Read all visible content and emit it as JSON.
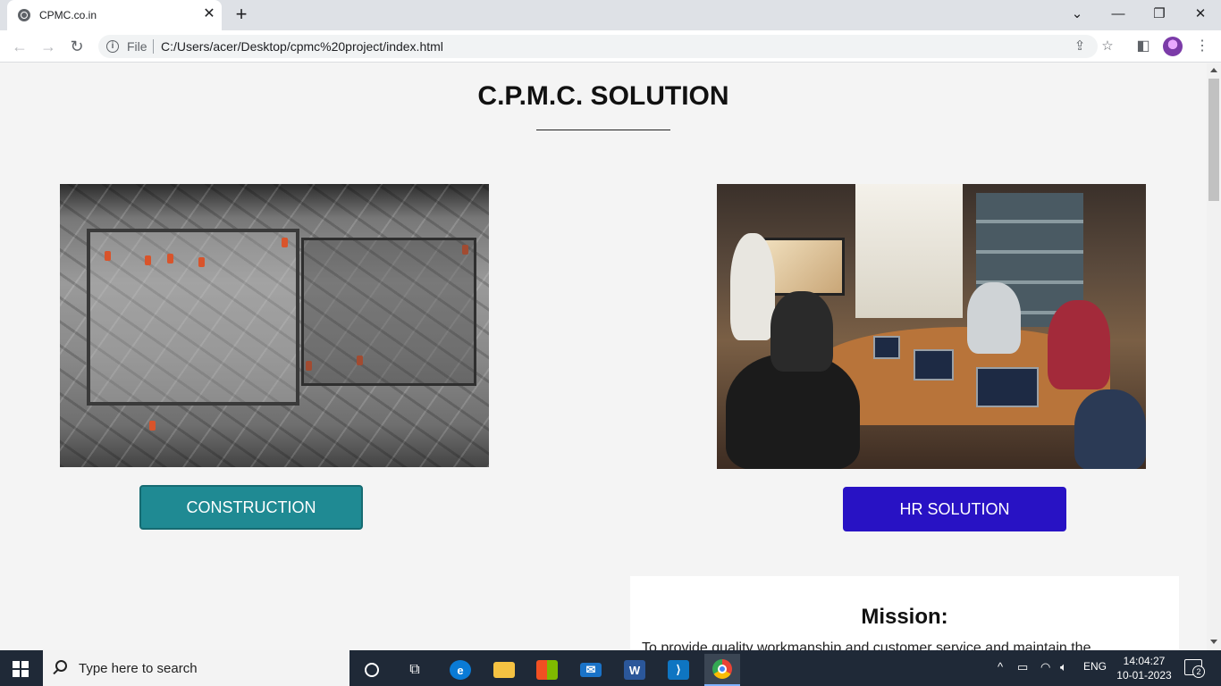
{
  "browser": {
    "tab_title": "CPMC.co.in",
    "file_label": "File",
    "url": "C:/Users/acer/Desktop/cpmc%20project/index.html",
    "new_tab_symbol": "+",
    "tab_close_symbol": "✕"
  },
  "page": {
    "title": "C.P.M.C. SOLUTION",
    "sections": [
      {
        "button_label": "CONSTRUCTION",
        "button_color": "#1f8a93"
      },
      {
        "button_label": "HR SOLUTION",
        "button_color": "#2812c4"
      }
    ],
    "mission": {
      "title": "Mission:",
      "text": "To provide quality workmanship and customer service and maintain the"
    }
  },
  "taskbar": {
    "search_placeholder": "Type here to search",
    "language": "ENG",
    "time": "14:04:27",
    "date": "10-01-2023",
    "notification_count": "2",
    "apps": [
      "cortana-icon",
      "task-view-icon",
      "edge-icon",
      "file-explorer-icon",
      "microsoft-store-icon",
      "mail-icon",
      "word-icon",
      "vscode-icon",
      "chrome-icon"
    ]
  },
  "colors": {
    "accent_teal": "#1f8a93",
    "accent_indigo": "#2812c4",
    "page_background": "#f4f4f4",
    "taskbar": "#1f2937"
  }
}
